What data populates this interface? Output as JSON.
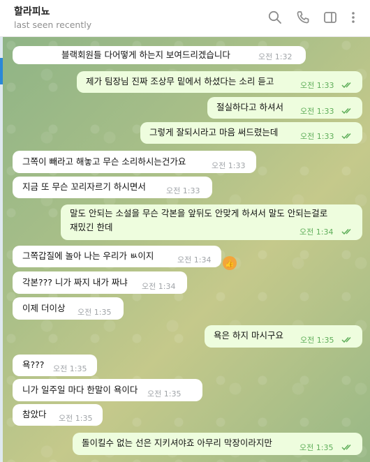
{
  "header": {
    "title": "할라피뇨",
    "status": "last seen recently"
  },
  "messages": [
    {
      "text": "블랙회원들 다어떻게 하는지 보여드리겠습니다",
      "time": "오전 1:32",
      "dir": "in"
    },
    {
      "text": "제가 팀장님 진짜 조상무 밑에서 하셨다는 소리 듣고",
      "time": "오전 1:33",
      "dir": "out"
    },
    {
      "text": "절실하다고 하셔서",
      "time": "오전 1:33",
      "dir": "out"
    },
    {
      "text": "그렇게 잘되시라고 마음 써드렸는데",
      "time": "오전 1:33",
      "dir": "out"
    },
    {
      "text": "그쪽이 빼라고 해놓고 무슨 소리하시는건가요",
      "time": "오전 1:33",
      "dir": "in"
    },
    {
      "text": "지금 또 무슨 꼬리자르기 하시면서",
      "time": "오전 1:33",
      "dir": "in"
    },
    {
      "line1": "말도 안되는 소설을 무슨 각본을 앞뒤도 안맞게 하셔서 말도 안되는걸로",
      "line2": "재밌긴 한데",
      "time": "오전 1:34",
      "dir": "out"
    },
    {
      "text": "그쪽갑질에 놀아 나는 우리가 ㅄ이지",
      "time": "오전 1:34",
      "dir": "in",
      "reaction": "👍"
    },
    {
      "text": "각본??? 니가 짜지 내가 짜냐",
      "time": "오전 1:34",
      "dir": "in"
    },
    {
      "text": "이제 더이상",
      "time": "오전 1:35",
      "dir": "in"
    },
    {
      "text": "욕은 하지 마시구요",
      "time": "오전 1:35",
      "dir": "out"
    },
    {
      "text": "욕???",
      "time": "오전 1:35",
      "dir": "in"
    },
    {
      "text": "니가 일주일 마다 한말이 욕이다",
      "time": "오전 1:35",
      "dir": "in"
    },
    {
      "text": "참았다",
      "time": "오전 1:35",
      "dir": "in"
    },
    {
      "text": "돌이킬수 없는 선은 지키셔야죠 아무리 막장이라지만",
      "time": "오전 1:35",
      "dir": "out"
    }
  ],
  "colors": {
    "incoming_bubble": "#ffffff",
    "outgoing_bubble": "#eefdde",
    "read_ticks": "#5fae5a"
  },
  "icons": [
    "search-icon",
    "phone-icon",
    "sidebar-toggle-icon",
    "more-vertical-icon"
  ]
}
